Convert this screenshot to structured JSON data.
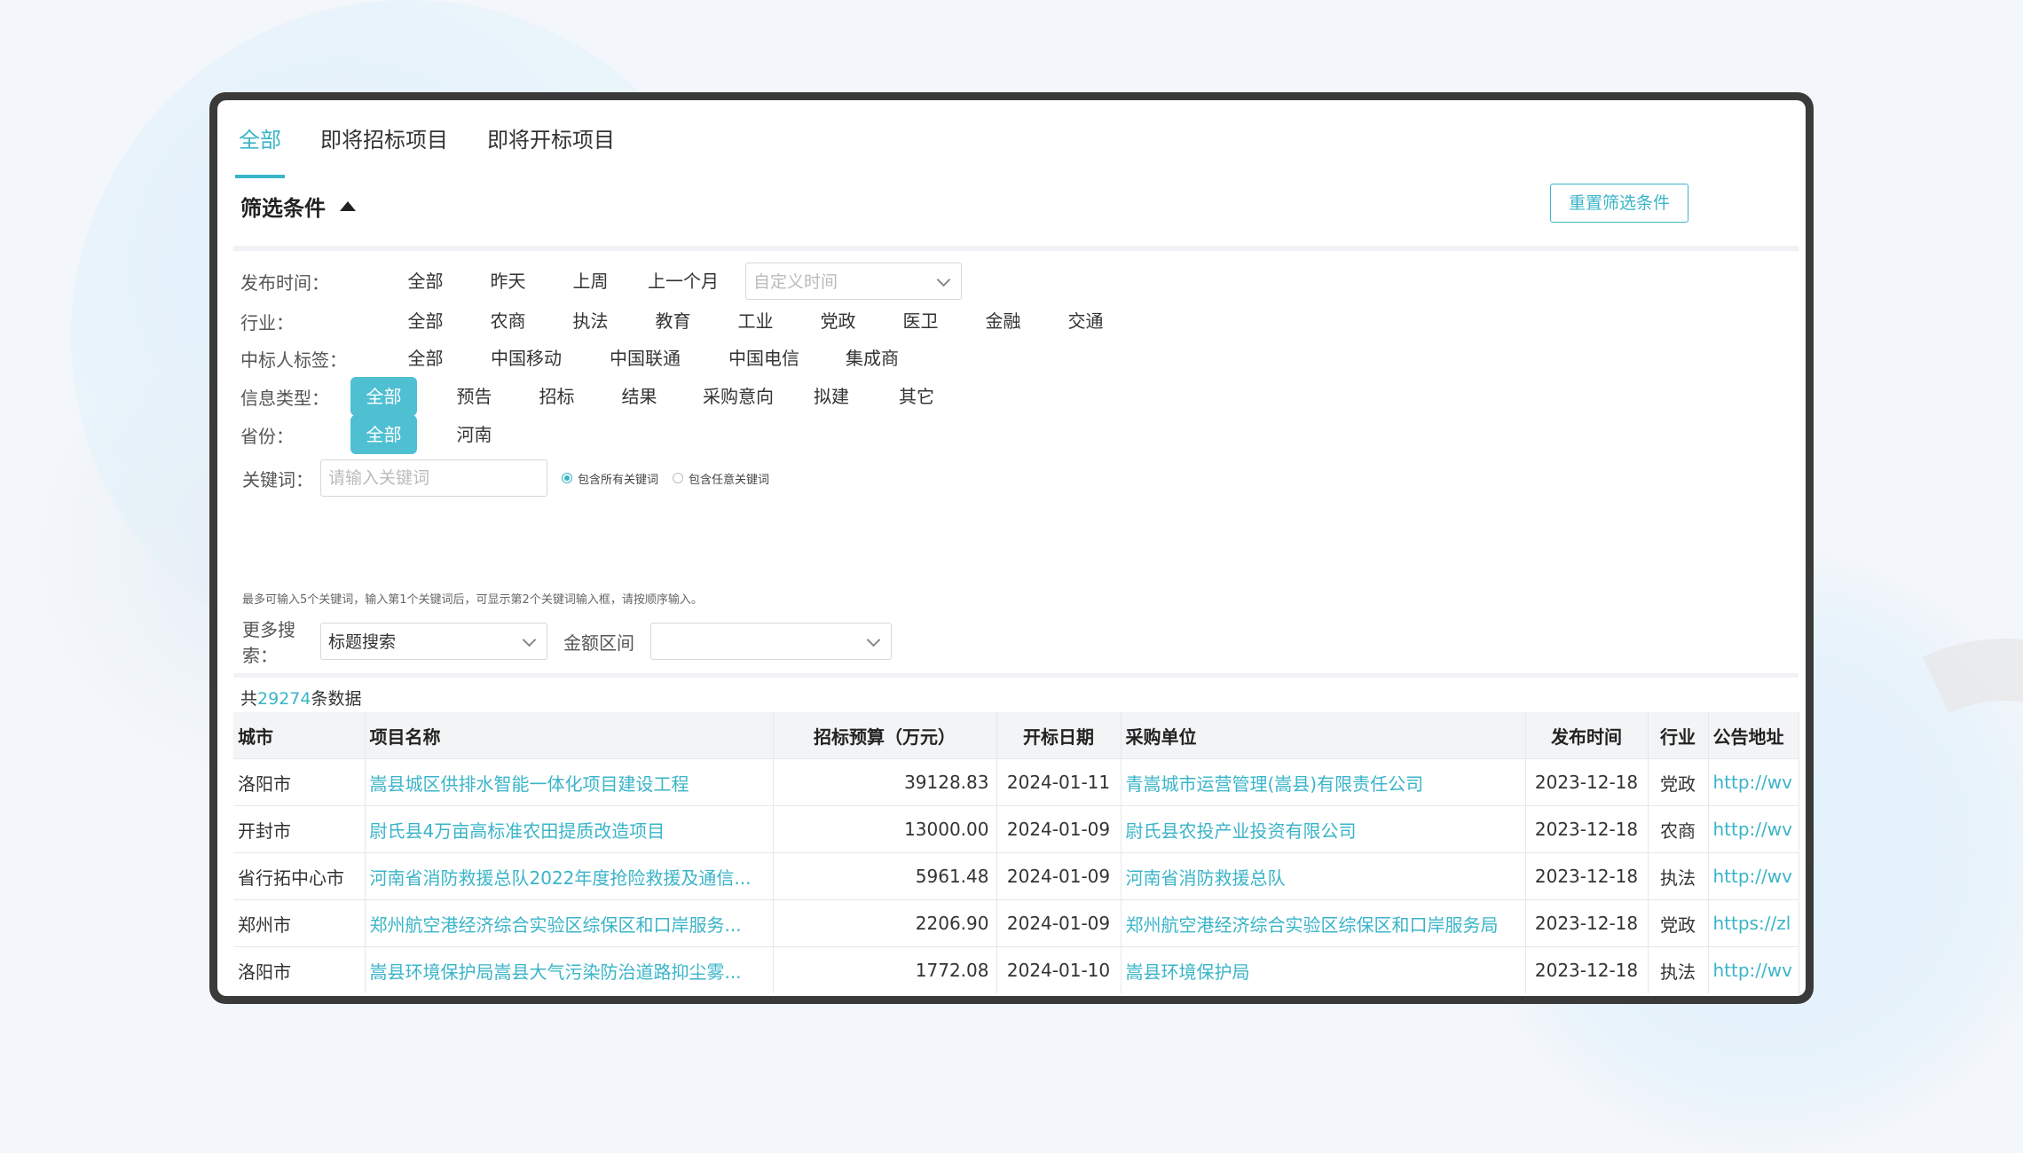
{
  "tabs": [
    {
      "label": "全部"
    },
    {
      "label": "即将招标项目"
    },
    {
      "label": "即将开标项目"
    }
  ],
  "filter": {
    "title": "筛选条件",
    "reset_label": "重置筛选条件",
    "publish_time": {
      "label": "发布时间：",
      "options": [
        "全部",
        "昨天",
        "上周",
        "上一个月"
      ],
      "custom_placeholder": "自定义时间"
    },
    "industry": {
      "label": "行业：",
      "options": [
        "全部",
        "农商",
        "执法",
        "教育",
        "工业",
        "党政",
        "医卫",
        "金融",
        "交通"
      ]
    },
    "winner_tag": {
      "label": "中标人标签：",
      "options": [
        "全部",
        "中国移动",
        "中国联通",
        "中国电信",
        "集成商"
      ]
    },
    "info_type": {
      "label": "信息类型：",
      "selected": "全部",
      "options": [
        "全部",
        "预告",
        "招标",
        "结果",
        "采购意向",
        "拟建",
        "其它"
      ]
    },
    "province": {
      "label": "省份：",
      "selected": "全部",
      "options": [
        "全部",
        "河南"
      ]
    },
    "keyword": {
      "label": "关键词：",
      "placeholder": "请输入关键词",
      "radio_all": "包含所有关键词",
      "radio_any": "包含任意关键词",
      "hint": "最多可输入5个关键词，输入第1个关键词后，可显示第2个关键词输入框，请按顺序输入。"
    },
    "more_search": {
      "label": "更多搜索：",
      "value": "标题搜索",
      "amount_label": "金额区间",
      "amount_value": ""
    }
  },
  "result": {
    "prefix": "共",
    "count": "29274",
    "suffix": "条数据"
  },
  "table": {
    "headers": [
      "城市",
      "项目名称",
      "招标预算（万元）",
      "开标日期",
      "采购单位",
      "发布时间",
      "行业",
      "公告地址"
    ],
    "rows": [
      {
        "city": "洛阳市",
        "name": "嵩县城区供排水智能一体化项目建设工程",
        "budget": "39128.83",
        "open_date": "2024-01-11",
        "buyer": "青嵩城市运营管理(嵩县)有限责任公司",
        "pub_date": "2023-12-18",
        "industry": "党政",
        "url": "http://wv"
      },
      {
        "city": "开封市",
        "name": "尉氏县4万亩高标准农田提质改造项目",
        "budget": "13000.00",
        "open_date": "2024-01-09",
        "buyer": "尉氏县农投产业投资有限公司",
        "pub_date": "2023-12-18",
        "industry": "农商",
        "url": "http://wv"
      },
      {
        "city": "省行拓中心市",
        "name": "河南省消防救援总队2022年度抢险救援及通信...",
        "budget": "5961.48",
        "open_date": "2024-01-09",
        "buyer": "河南省消防救援总队",
        "pub_date": "2023-12-18",
        "industry": "执法",
        "url": "http://wv"
      },
      {
        "city": "郑州市",
        "name": "郑州航空港经济综合实验区综保区和口岸服务...",
        "budget": "2206.90",
        "open_date": "2024-01-09",
        "buyer": "郑州航空港经济综合实验区综保区和口岸服务局",
        "pub_date": "2023-12-18",
        "industry": "党政",
        "url": "https://zl"
      },
      {
        "city": "洛阳市",
        "name": "嵩县环境保护局嵩县大气污染防治道路抑尘雾...",
        "budget": "1772.08",
        "open_date": "2024-01-10",
        "buyer": "嵩县环境保护局",
        "pub_date": "2023-12-18",
        "industry": "执法",
        "url": "http://wv"
      }
    ]
  }
}
